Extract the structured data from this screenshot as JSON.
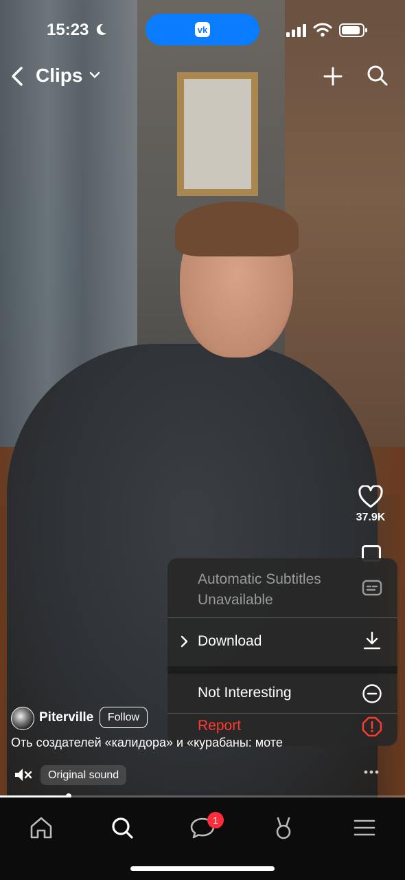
{
  "status_bar": {
    "time": "15:23"
  },
  "header": {
    "title": "Clips"
  },
  "actions": {
    "likes": "37.9K"
  },
  "menu": {
    "items": [
      {
        "label": "Automatic Subtitles Unavailable",
        "icon": "subtitles-icon",
        "disabled": true
      },
      {
        "label": "Download",
        "icon": "download-icon"
      },
      {
        "label": "Not Interesting",
        "icon": "minus-circle-icon"
      },
      {
        "label": "Report",
        "icon": "alert-octagon-icon",
        "color": "#ff3b30"
      }
    ]
  },
  "clip": {
    "author": "Piterville",
    "follow_label": "Follow",
    "caption": "Оть создателей «калидора» и «курабаны: моте",
    "sound_label": "Original sound",
    "progress": 0.17
  },
  "tabbar": {
    "tabs": [
      "home-icon",
      "search-icon",
      "messages-icon",
      "clips-icon",
      "menu-icon"
    ],
    "messages_badge": "1"
  },
  "colors": {
    "accent": "#0a7cff",
    "danger": "#ff3b30",
    "badge": "#ff2d3c"
  }
}
